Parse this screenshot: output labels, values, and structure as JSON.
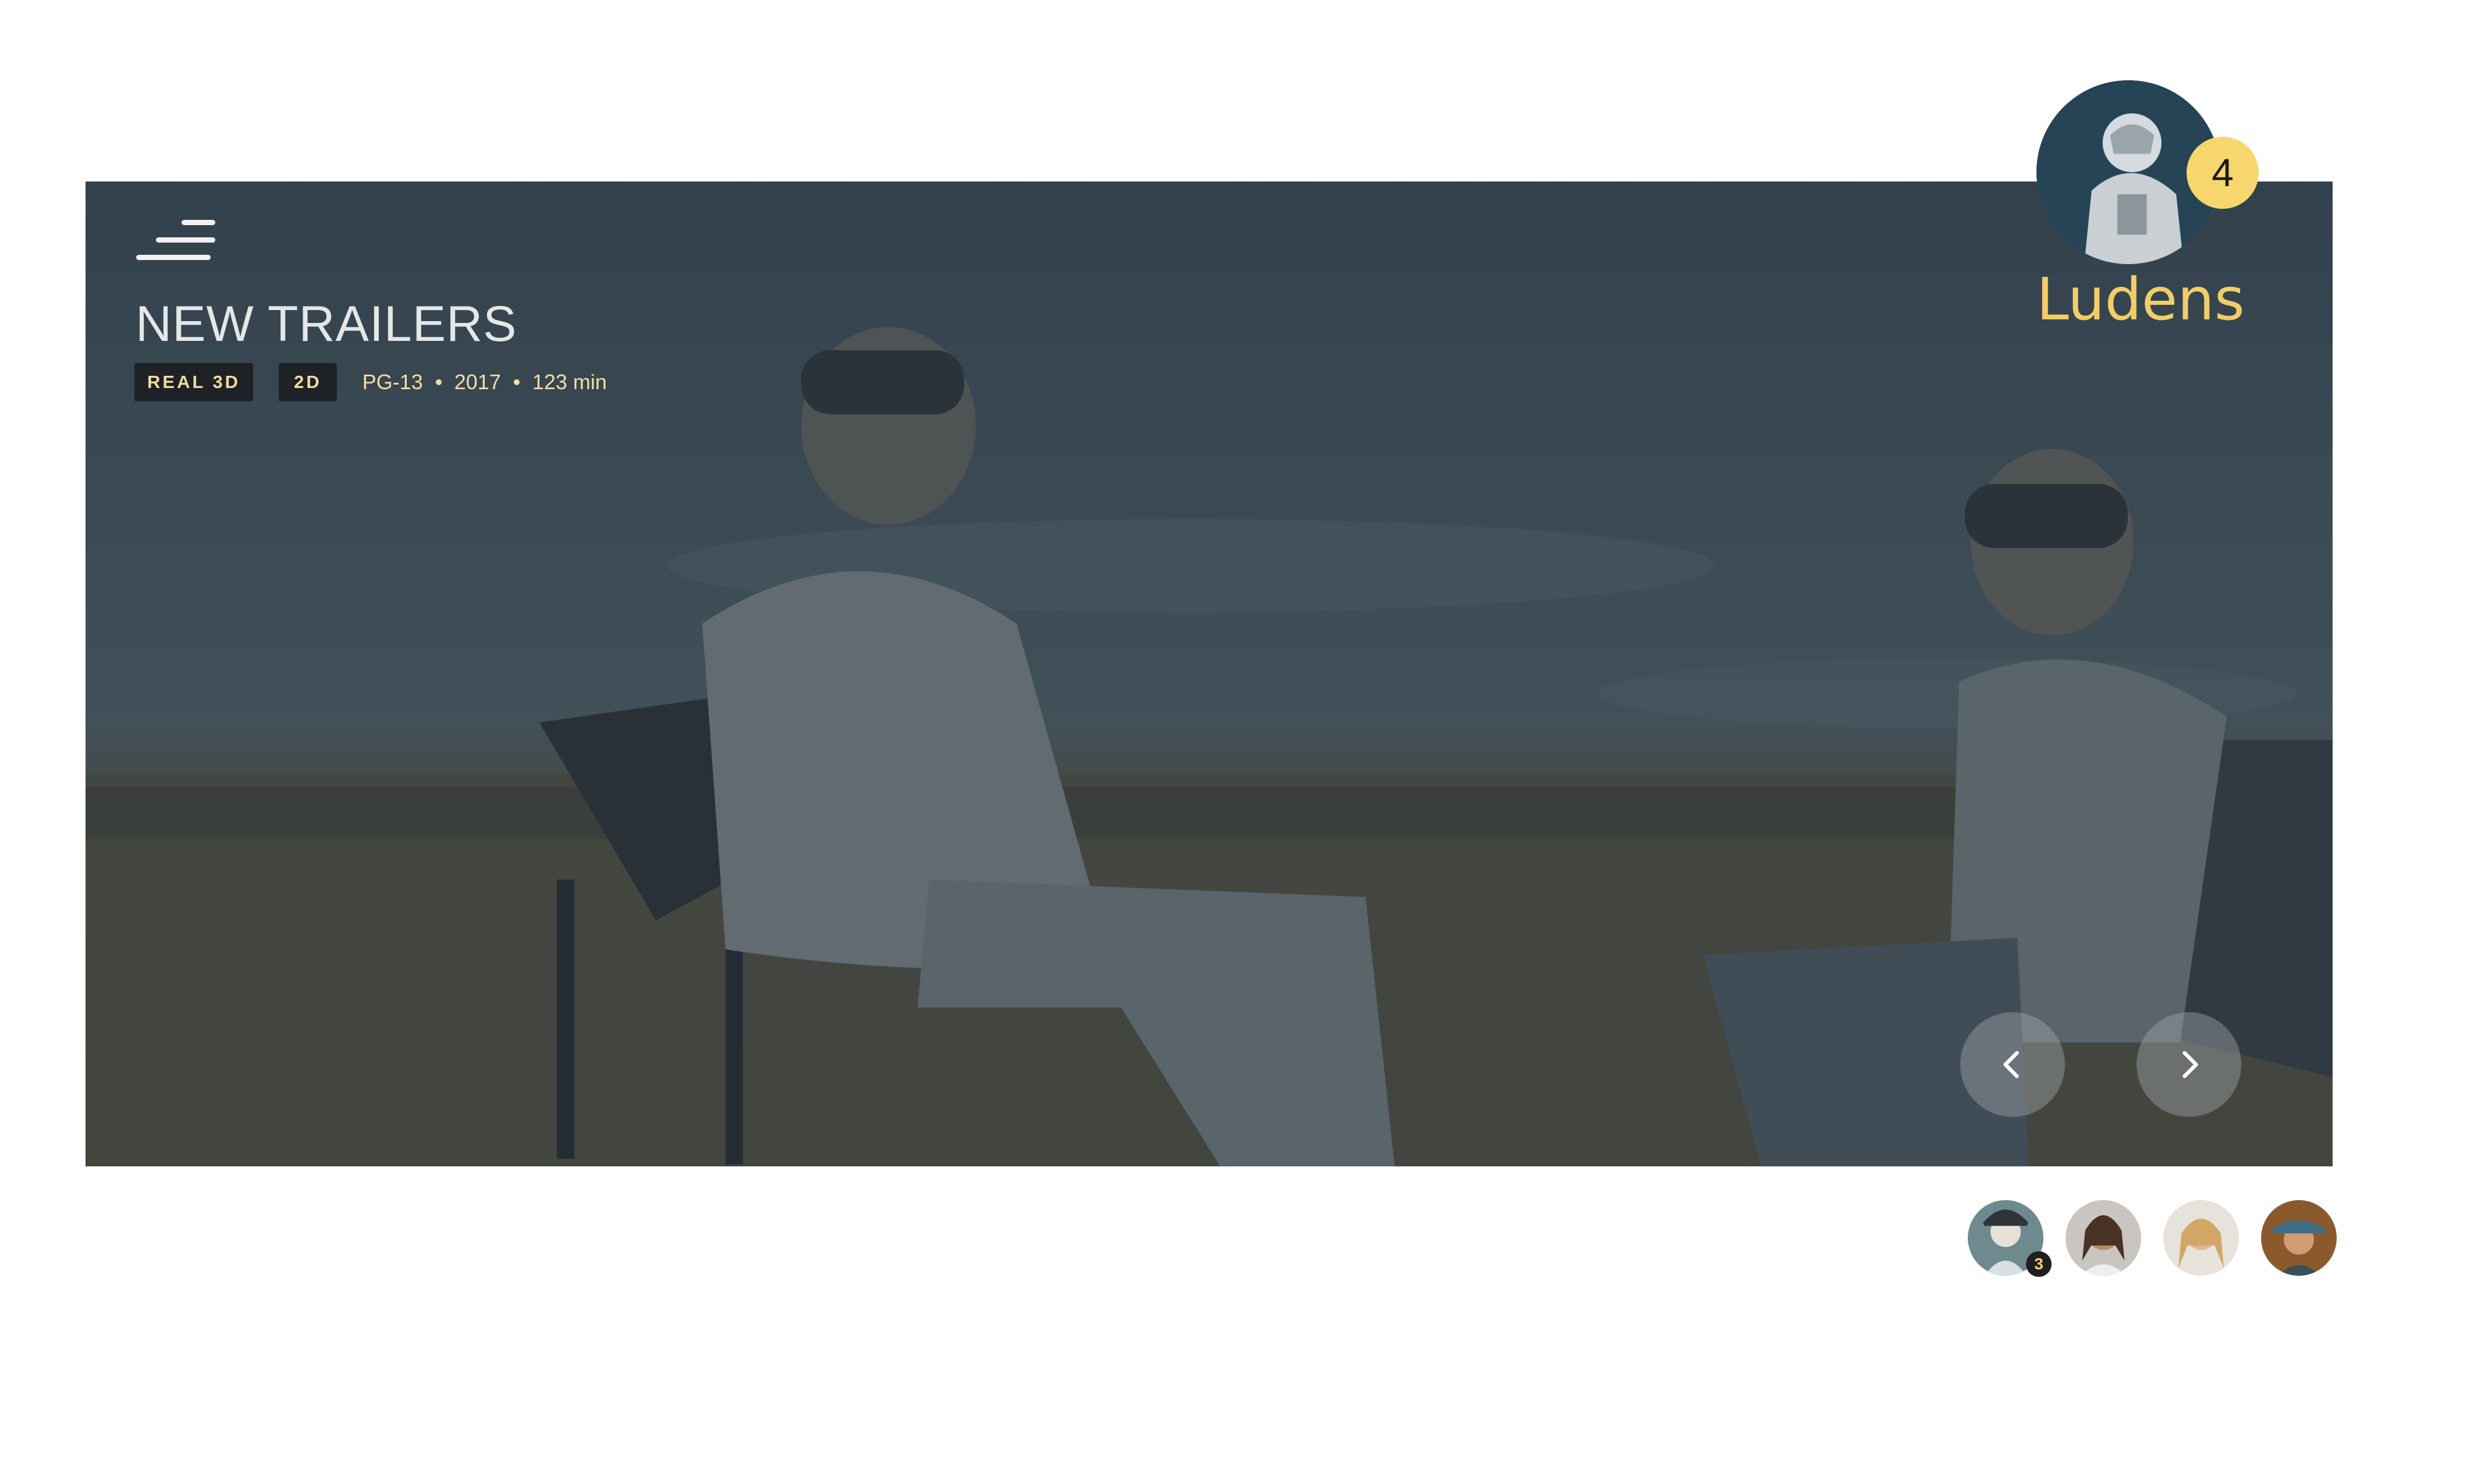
{
  "hero": {
    "title": "NEW TRAILERS",
    "badges": [
      "REAL 3D",
      "2D"
    ],
    "rating": "PG-13",
    "year": "2017",
    "duration": "123 min"
  },
  "profile": {
    "name": "Ludens",
    "notification_count": "4"
  },
  "friends": {
    "first_badge_count": "3"
  },
  "icons": {
    "menu": "hamburger-menu-icon",
    "prev": "chevron-left-icon",
    "next": "chevron-right-icon"
  },
  "colors": {
    "accent": "#f2cd67",
    "badge_bg": "#1e2226",
    "notif": "#f7d76d"
  }
}
